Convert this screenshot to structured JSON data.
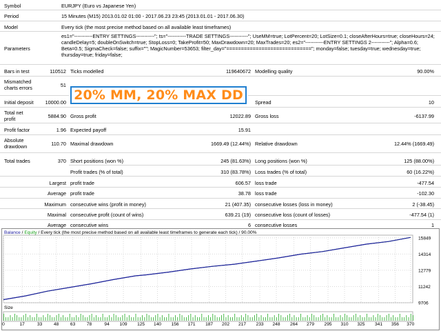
{
  "report": {
    "symbol": {
      "label": "Symbol",
      "value": "EURJPY (Euro vs Japanese Yen)"
    },
    "period": {
      "label": "Period",
      "value": "15 Minutes (M15) 2013.01.02 01:00 - 2017.06.23 23:45 (2013.01.01 - 2017.06.30)"
    },
    "model": {
      "label": "Model",
      "value": "Every tick (the most precise method based on all available least timeframes)"
    },
    "parameters": {
      "label": "Parameters",
      "value": "es1=\"-----------ENTRY SETTINGS-----------\"; ts=\"-----------TRADE SETTINGS-----------\"; UseMM=true; LotPercent=20; LotSize=0.1; closeAfterHours=true; closeHours=24; candleDelay=5; doubleOnSwitch=true; StopLoss=0; TakeProfit=50; MaxDrawdown=20; MaxTrades=20; es2=\"-----------ENTRY SETTINGS 2-----------\"; Alpha=0.6; Beta=0.5; SigmaCheck=false; suffix=\"\"; MagicNumber=53653; filter_day=\"=============================\"; monday=false; tuesday=true; wednesday=true; thursday=true; friday=false;"
    },
    "bars": {
      "label": "Bars in test",
      "value": "110512"
    },
    "ticks": {
      "label": "Ticks modelled",
      "value": "119640672"
    },
    "quality": {
      "label": "Modelling quality",
      "value": "90.00%"
    },
    "mismatched": {
      "label": "Mismatched charts errors",
      "value": "51"
    },
    "deposit": {
      "label": "Initial deposit",
      "value": "10000.00"
    },
    "spread": {
      "label": "Spread",
      "value": "10"
    },
    "net_profit": {
      "label": "Total net profit",
      "value": "5884.90"
    },
    "gross_profit": {
      "label": "Gross profit",
      "value": "12022.89"
    },
    "gross_loss": {
      "label": "Gross loss",
      "value": "-6137.99"
    },
    "profit_factor": {
      "label": "Profit factor",
      "value": "1.96"
    },
    "expected_payoff": {
      "label": "Expected payoff",
      "value": "15.91"
    },
    "abs_dd": {
      "label": "Absolute drawdown",
      "value": "110.70"
    },
    "max_dd": {
      "label": "Maximal drawdown",
      "value": "1669.49 (12.44%)"
    },
    "rel_dd": {
      "label": "Relative drawdown",
      "value": "12.44% (1669.49)"
    },
    "total_trades": {
      "label": "Total trades",
      "value": "370"
    },
    "short_pos": {
      "label": "Short positions (won %)",
      "value": "245 (81.63%)"
    },
    "long_pos": {
      "label": "Long positions (won %)",
      "value": "125 (88.00%)"
    },
    "profit_trades": {
      "label": "Profit trades (% of total)",
      "value": "310 (83.78%)"
    },
    "loss_trades": {
      "label": "Loss trades (% of total)",
      "value": "60 (16.22%)"
    },
    "largest": {
      "label": "Largest",
      "profit_label": "profit trade",
      "profit": "606.57",
      "loss_label": "loss trade",
      "loss": "-477.54"
    },
    "average": {
      "label": "Average",
      "profit_label": "profit trade",
      "profit": "38.78",
      "loss_label": "loss trade",
      "loss": "-102.30"
    },
    "maximum": {
      "label": "Maximum",
      "wins_label": "consecutive wins (profit in money)",
      "wins": "21 (407.35)",
      "losses_label": "consecutive losses (loss in money)",
      "losses": "2 (-38.45)"
    },
    "maximal": {
      "label": "Maximal",
      "profit_label": "consecutive profit (count of wins)",
      "profit": "639.21 (19)",
      "loss_label": "consecutive loss (count of losses)",
      "loss": "-477.54 (1)"
    },
    "average_consec": {
      "label": "Average",
      "wins_label": "consecutive wins",
      "wins": "6",
      "losses_label": "consecutive losses",
      "losses": "1"
    }
  },
  "banner": {
    "text": "20% MM, 20% MAX DD"
  },
  "chart_header": {
    "balance": "Balance",
    "sep1": " / ",
    "equity": "Equity",
    "rest": " / Every tick (the most precise method based on all available least timeframes to generate each tick) / 90.00%"
  },
  "colors": {
    "balance": "#1e1ea0",
    "equity": "#1aa01a",
    "banner_text": "#ff8c1a",
    "banner_border": "#1f7fd0",
    "size_bar": "#22aa22"
  },
  "chart_data": {
    "type": "line",
    "series": [
      {
        "name": "Balance",
        "x": [
          0,
          20,
          40,
          60,
          80,
          100,
          120,
          130,
          150,
          170,
          190,
          210,
          230,
          250,
          270,
          290,
          310,
          330,
          350,
          370
        ],
        "y": [
          10000,
          10350,
          10800,
          11150,
          11500,
          11900,
          12250,
          12350,
          12600,
          12900,
          13150,
          13350,
          13650,
          13950,
          14300,
          14550,
          14900,
          15250,
          15500,
          15885
        ]
      },
      {
        "name": "Equity",
        "x": [
          0,
          20,
          40,
          60,
          80,
          100,
          120,
          130,
          150,
          170,
          190,
          210,
          230,
          250,
          270,
          290,
          310,
          330,
          350,
          370
        ],
        "y": [
          10000,
          10350,
          10800,
          11150,
          11500,
          11900,
          12250,
          12350,
          12600,
          12900,
          13150,
          13350,
          13650,
          13950,
          14300,
          14550,
          14900,
          15250,
          15500,
          15885
        ]
      }
    ],
    "y_ticks": [
      "15849",
      "14314",
      "12779",
      "11242",
      "9706"
    ],
    "y_tick_values": [
      15849,
      14314,
      12779,
      11242,
      9706
    ],
    "ylim": [
      9706,
      16100
    ],
    "xlim": [
      0,
      372
    ],
    "x_ticks": [
      "0",
      "17",
      "33",
      "48",
      "63",
      "78",
      "94",
      "109",
      "125",
      "140",
      "156",
      "171",
      "187",
      "202",
      "217",
      "233",
      "248",
      "264",
      "279",
      "295",
      "310",
      "325",
      "341",
      "356",
      "370"
    ],
    "x_tick_values": [
      0,
      17,
      33,
      48,
      63,
      78,
      94,
      109,
      125,
      140,
      156,
      171,
      187,
      202,
      217,
      233,
      248,
      264,
      279,
      295,
      310,
      325,
      341,
      356,
      370
    ],
    "size_label": "Size",
    "grid": true
  }
}
